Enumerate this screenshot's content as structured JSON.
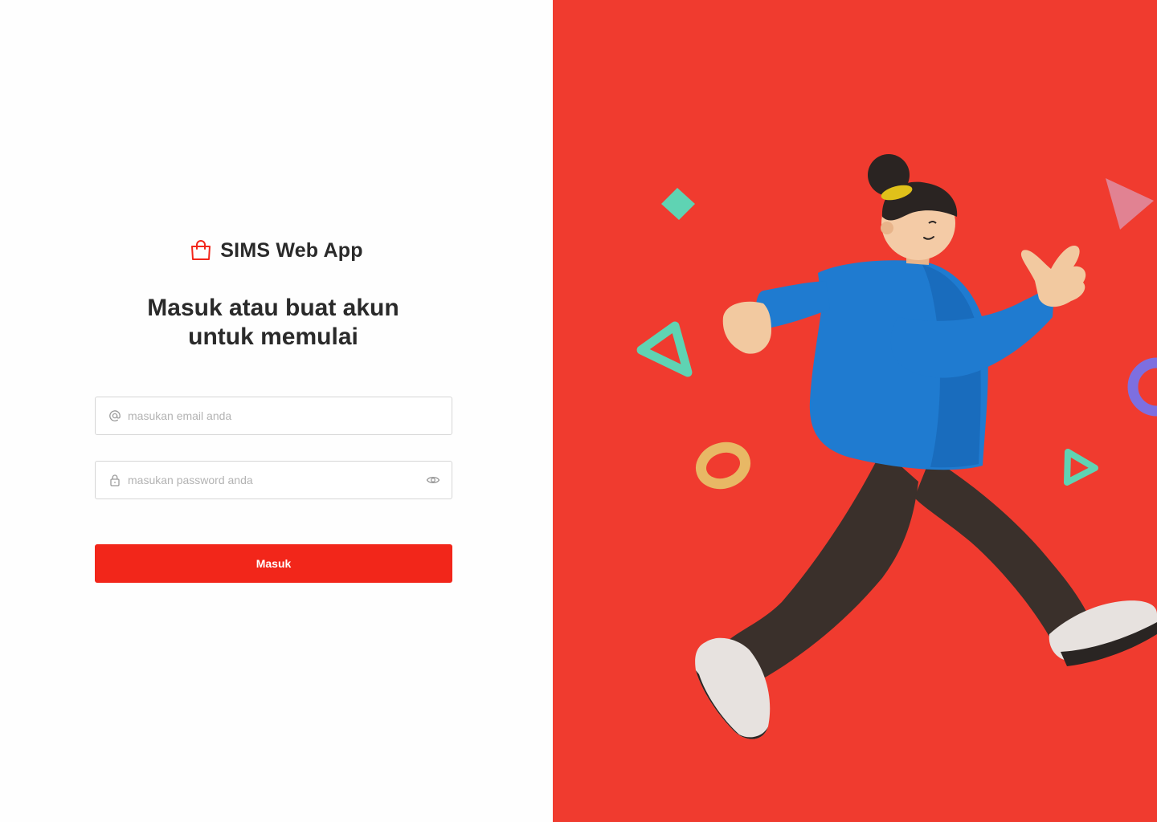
{
  "app": {
    "name": "SIMS Web App",
    "logo_icon": "shopping-bag-icon"
  },
  "login": {
    "heading_line1": "Masuk atau buat akun",
    "heading_line2": "untuk memulai",
    "email": {
      "placeholder": "masukan email anda",
      "value": "",
      "icon": "at-sign-icon"
    },
    "password": {
      "placeholder": "masukan password anda",
      "value": "",
      "icon": "lock-icon",
      "toggle_icon": "eye-icon"
    },
    "submit_label": "Masuk"
  },
  "colors": {
    "accent": "#f2261a",
    "illustration_bg": "#f03b2f",
    "text": "#2a2a2a",
    "border": "#d6d6d6",
    "placeholder": "#b3b3b3"
  }
}
